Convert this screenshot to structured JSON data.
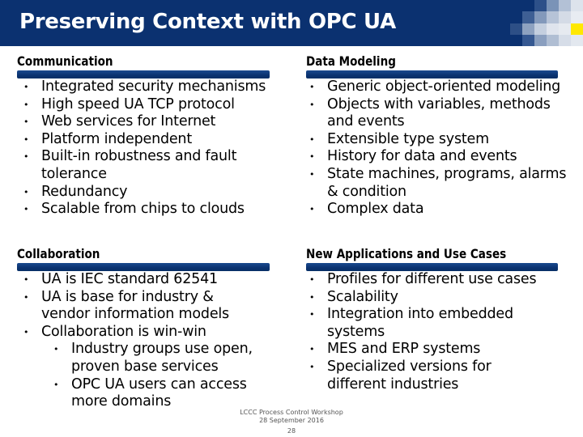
{
  "slide": {
    "title": "Preserving Context with OPC UA",
    "colors": {
      "title_bar": "#0b3170",
      "section_bar": "#0a3270",
      "mosaic_accent": "#ffe800"
    },
    "mosaic_cells": [
      "#0b3170",
      "#0b3170",
      "#2d5089",
      "#7a93b7",
      "#b3c1d6",
      "#dde3ec",
      "#0b3170",
      "#3e5f94",
      "#8399bb",
      "#b6c3d7",
      "#d4dbe6",
      "#e8ecf2",
      "#2d4f86",
      "#8ea2c0",
      "#c4cfdf",
      "#dfe4ed",
      "#e6eaf0",
      "#ffe800",
      "#0b3170",
      "#355891",
      "#8a9fbf",
      "#b0bed3",
      "#d6dde8",
      "#e3e8ef"
    ]
  },
  "sections": {
    "communication": {
      "heading": "Communication",
      "items": [
        {
          "text": "Integrated security mechanisms"
        },
        {
          "text": "High speed UA TCP protocol"
        },
        {
          "text": "Web services for Internet"
        },
        {
          "text": "Platform independent"
        },
        {
          "text": "Built-in robustness and fault",
          "cont": "tolerance"
        },
        {
          "text": "Redundancy"
        },
        {
          "text": "Scalable from chips to clouds"
        }
      ]
    },
    "data_modeling": {
      "heading": "Data Modeling",
      "items": [
        {
          "text": "Generic object-oriented modeling"
        },
        {
          "text": "Objects with variables, methods",
          "cont": "and events"
        },
        {
          "text": "Extensible type system"
        },
        {
          "text": "History for data and events"
        },
        {
          "text": "State machines, programs, alarms",
          "cont": "& condition"
        },
        {
          "text": "Complex data"
        }
      ]
    },
    "collaboration": {
      "heading": "Collaboration",
      "items": [
        {
          "text": "UA is IEC standard 62541"
        },
        {
          "text": "UA is base for industry &",
          "cont": "vendor information models"
        },
        {
          "text": "Collaboration is win-win"
        },
        {
          "text": "Industry groups use open,",
          "cont": "proven base services",
          "level": 2
        },
        {
          "text": "OPC UA users can access",
          "cont": "more domains",
          "level": 2
        }
      ]
    },
    "new_applications": {
      "heading": "New Applications and Use Cases",
      "items": [
        {
          "text": "Profiles for different use cases"
        },
        {
          "text": "Scalability"
        },
        {
          "text": "Integration into embedded",
          "cont": "systems"
        },
        {
          "text": "MES and ERP systems"
        },
        {
          "text": "Specialized versions for",
          "cont": "different industries"
        }
      ]
    }
  },
  "footer": {
    "event": "LCCC Process Control Workshop",
    "date": "28 September 2016",
    "page_number": "28"
  }
}
